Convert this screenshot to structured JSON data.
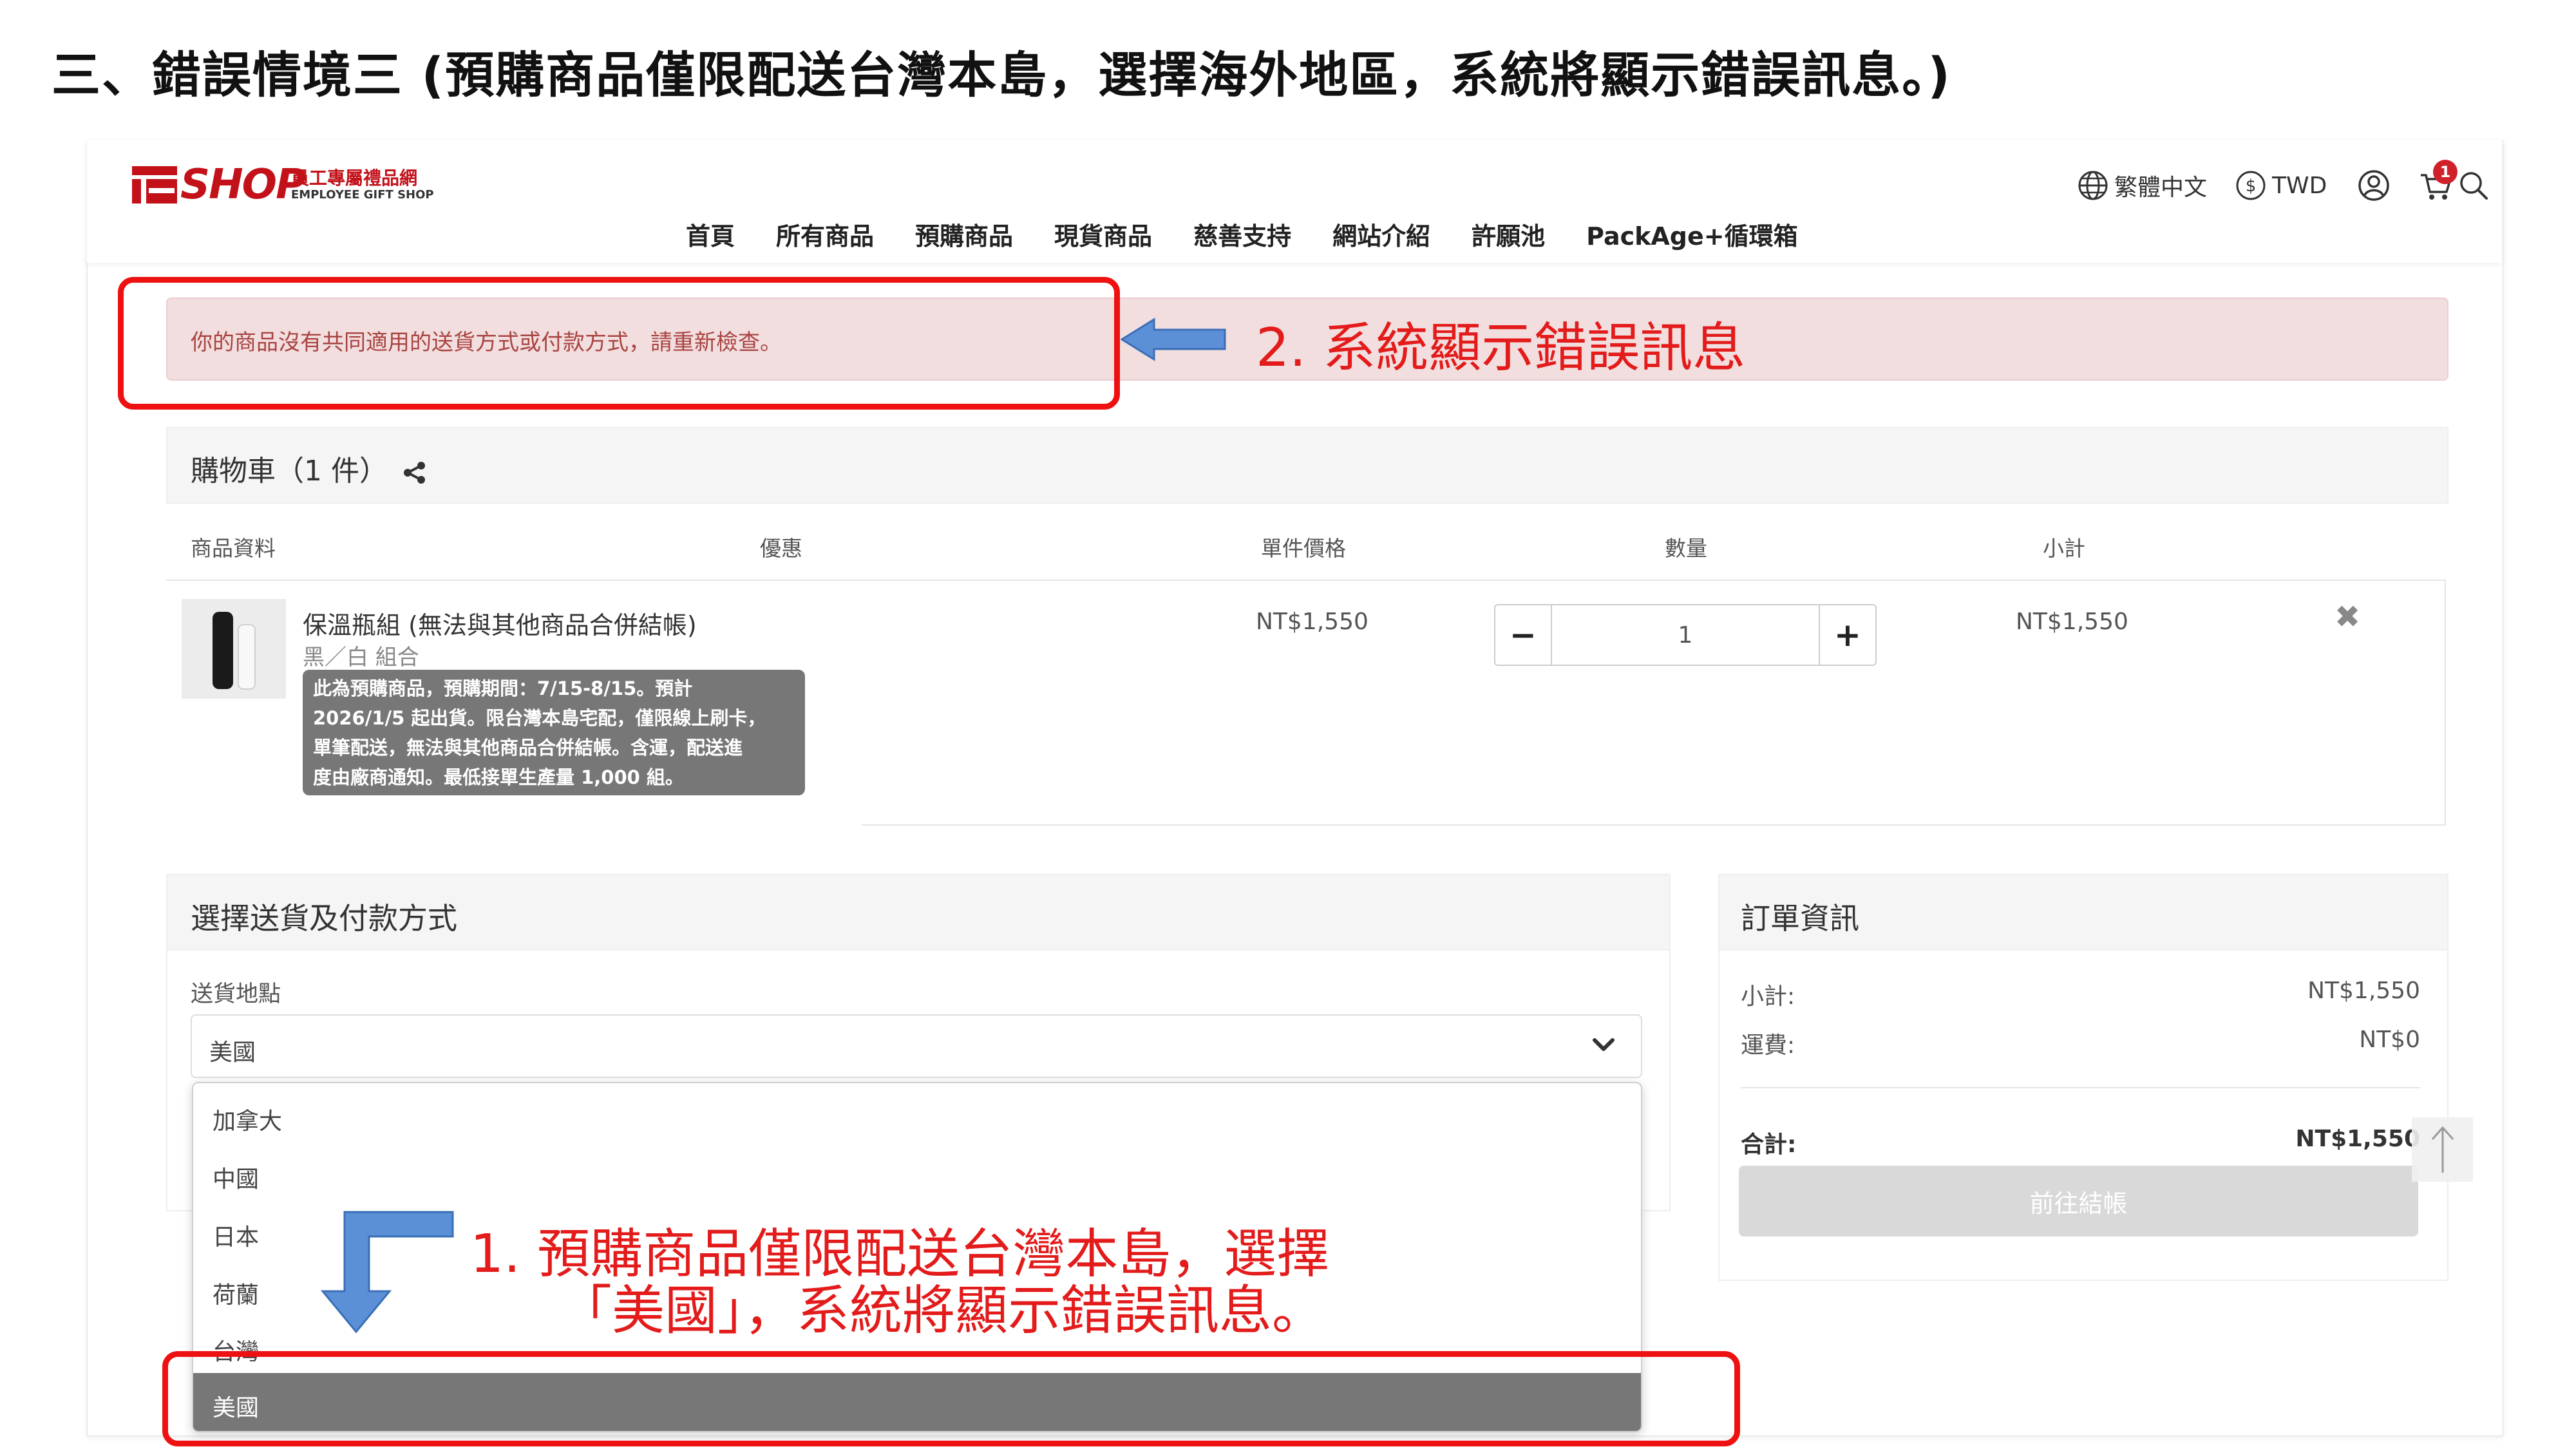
{
  "document": {
    "title": "三、錯誤情境三 (預購商品僅限配送台灣本島，選擇海外地區，系統將顯示錯誤訊息。)"
  },
  "header": {
    "logo_text": "SHOP",
    "logo_cn": "員工專屬禮品網",
    "logo_en": "EMPLOYEE GIFT SHOP",
    "nav": [
      "首頁",
      "所有商品",
      "預購商品",
      "現貨商品",
      "慈善支持",
      "網站介紹",
      "許願池",
      "PackAge+循環箱"
    ],
    "language": "繁體中文",
    "currency": "TWD",
    "cart_count": "1",
    "icons": [
      "globe-icon",
      "dollar-icon",
      "user-icon",
      "cart-icon",
      "search-icon"
    ]
  },
  "alert": {
    "message": "你的商品沒有共同適用的送貨方式或付款方式，請重新檢查。"
  },
  "annotations": {
    "step2": "2.  系統顯示錯誤訊息",
    "step1_line1": "1.  預購商品僅限配送台灣本島，選擇",
    "step1_line2": "「美國」，系統將顯示錯誤訊息。"
  },
  "cart": {
    "title": "購物車（1 件）",
    "headers": {
      "product": "商品資料",
      "discount": "優惠",
      "unit_price": "單件價格",
      "quantity": "數量",
      "subtotal": "小計"
    },
    "items": [
      {
        "name": "保溫瓶組 (無法與其他商品合併結帳)",
        "variant": "黑／白 組合",
        "note_lines": [
          "此為預購商品，預購期間：7/15-8/15。預計",
          "2026/1/5 起出貨。限台灣本島宅配，僅限線上刷卡，",
          "單筆配送，無法與其他商品合併結帳。含運，配送進",
          "度由廠商通知。最低接單生產量 1,000 組。"
        ],
        "unit_price": "NT$1,550",
        "quantity": "1",
        "subtotal": "NT$1,550",
        "qty_minus": "−",
        "qty_plus": "+",
        "remove": "✖"
      }
    ]
  },
  "shipping": {
    "title": "選擇送貨及付款方式",
    "location_label": "送貨地點",
    "selected": "美國",
    "options": [
      "加拿大",
      "中國",
      "日本",
      "荷蘭",
      "台灣",
      "美國"
    ]
  },
  "order": {
    "title": "訂單資訊",
    "subtotal_label": "小計:",
    "subtotal_value": "NT$1,550",
    "shipping_label": "運費:",
    "shipping_value": "NT$0",
    "total_label": "合計:",
    "total_value": "NT$1,550",
    "checkout_label": "前往結帳"
  },
  "colors": {
    "brand_red": "#c3111a",
    "annotation_red": "#ee1111",
    "alert_bg": "#f2dede",
    "arrow_blue": "#5b8fd6"
  }
}
